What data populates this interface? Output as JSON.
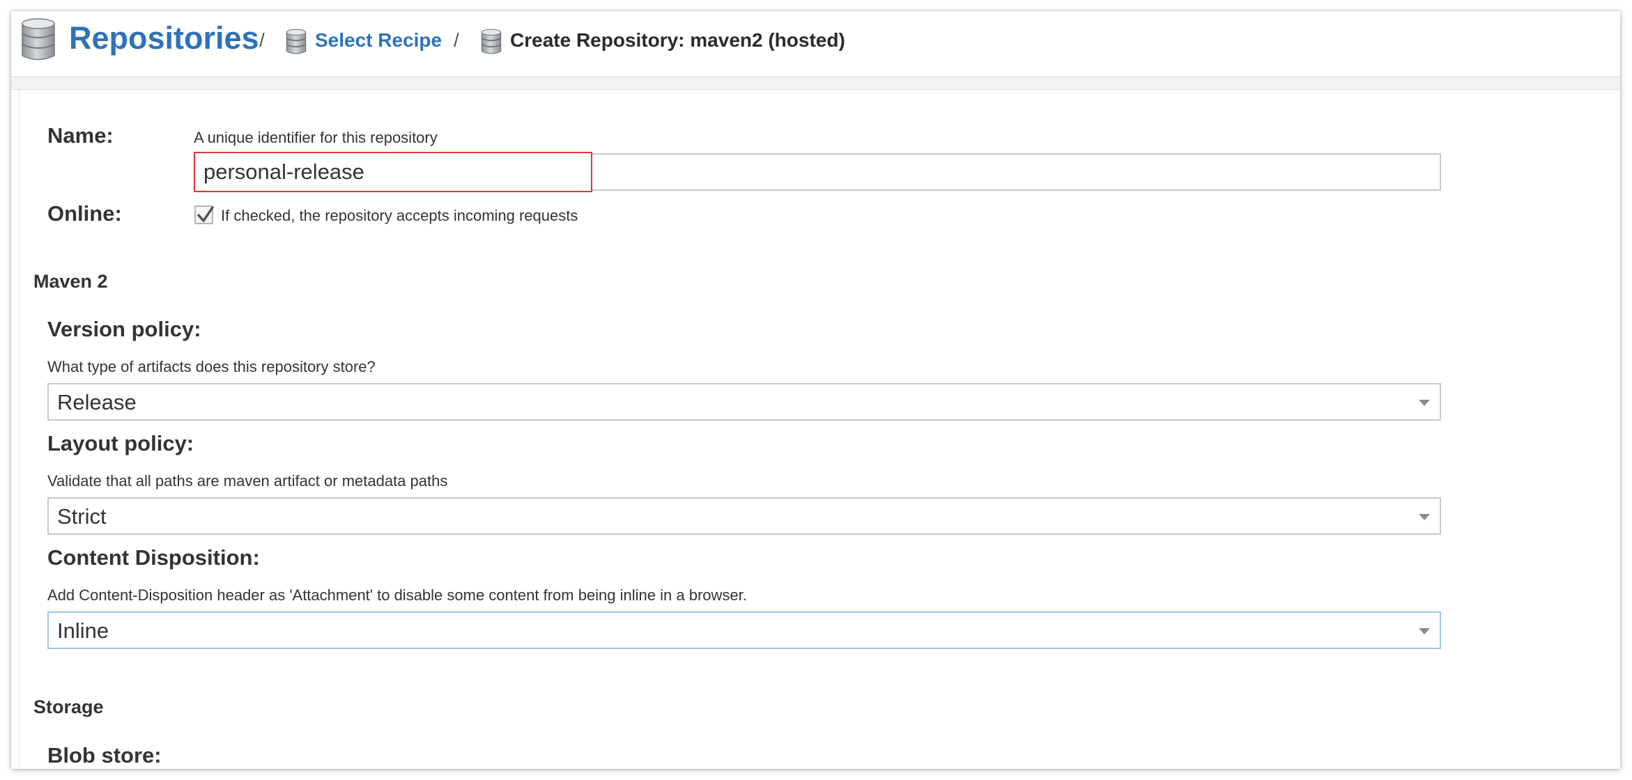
{
  "header": {
    "title": "Repositories",
    "separator": "/",
    "crumb_link": "Select Recipe",
    "crumb_current": "Create Repository: maven2 (hosted)",
    "icon": "database-icon"
  },
  "form": {
    "name": {
      "label": "Name:",
      "help": "A unique identifier for this repository",
      "value": "personal-release"
    },
    "online": {
      "label": "Online:",
      "checked": true,
      "help": "If checked, the repository accepts incoming requests"
    },
    "maven2": {
      "section_label": "Maven 2",
      "version_policy": {
        "label": "Version policy:",
        "help": "What type of artifacts does this repository store?",
        "value": "Release"
      },
      "layout_policy": {
        "label": "Layout policy:",
        "help": "Validate that all paths are maven artifact or metadata paths",
        "value": "Strict"
      },
      "content_disposition": {
        "label": "Content Disposition:",
        "help": "Add Content-Disposition header as 'Attachment' to disable some content from being inline in a browser.",
        "value": "Inline"
      }
    },
    "storage": {
      "section_label": "Storage",
      "blob_store": {
        "label": "Blob store:"
      }
    }
  },
  "colors": {
    "link_blue": "#2e72b8",
    "error_red": "#d93a3a",
    "focus_blue": "#9fc8e8"
  }
}
